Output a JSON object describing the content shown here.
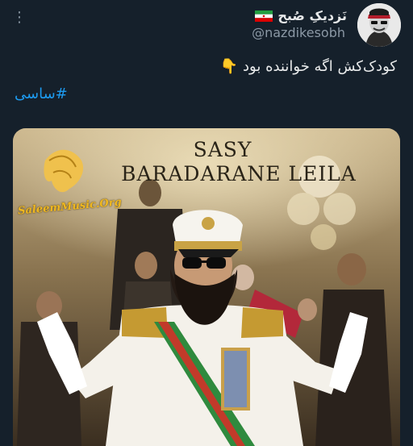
{
  "tweet": {
    "display_name": "نَزدیکِ صُبح",
    "handle": "@nazdikesobh",
    "text": "کودک‌کش اگه خواننده بود 👇",
    "hashtag": "#ساسی",
    "more_icon": "more-vertical-icon",
    "flag_icon": "iran-flag-icon"
  },
  "media": {
    "title_line1": "SASY",
    "title_line2": "BARADARANE LEILA",
    "watermark": "SaleemMusic.Org"
  },
  "colors": {
    "background": "#15202b",
    "text": "#e7e9ea",
    "muted": "#8b98a5",
    "link": "#1d9bf0"
  }
}
